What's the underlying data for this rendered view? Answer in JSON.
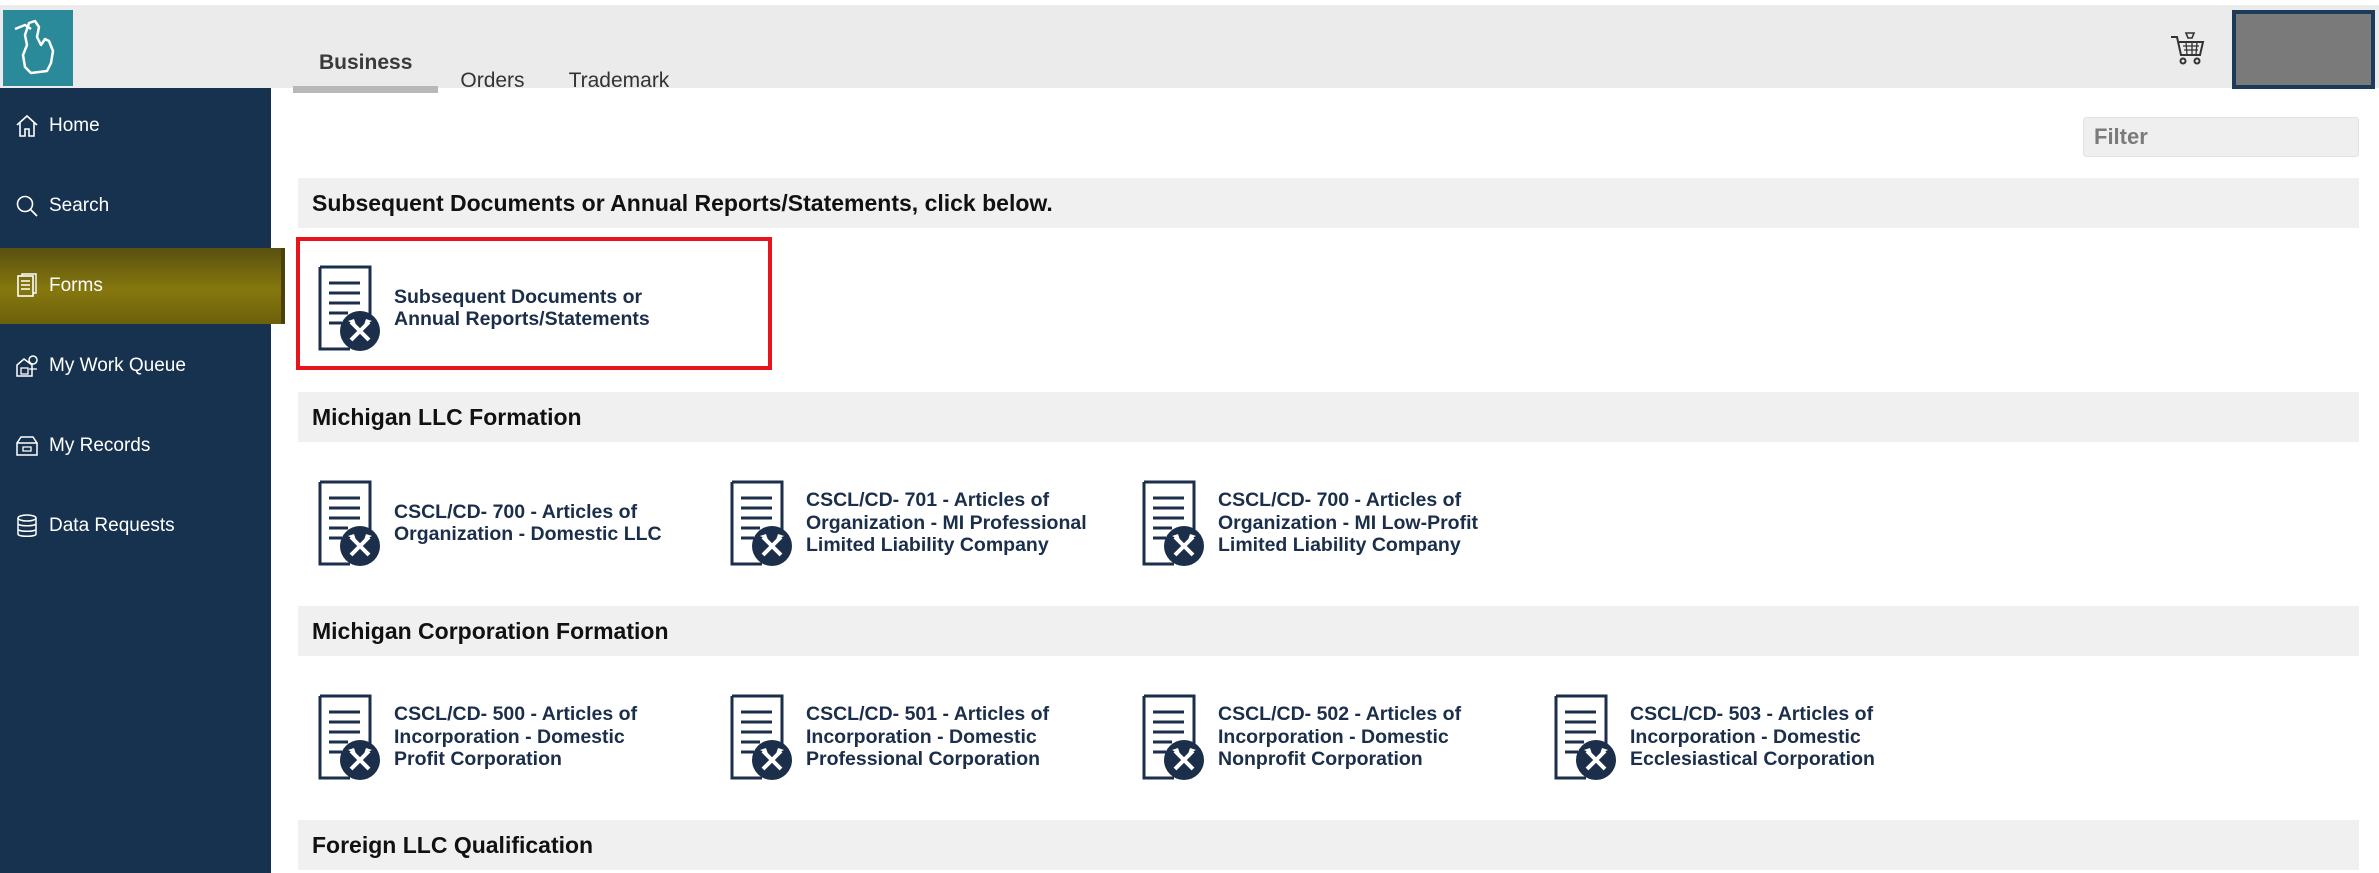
{
  "header": {
    "logo_icon": "michigan-state-icon",
    "tabs": [
      {
        "label": "Business"
      },
      {
        "label": "Orders"
      },
      {
        "label": "Trademark"
      }
    ],
    "cart_icon": "cart-icon"
  },
  "sidebar": {
    "items": [
      {
        "label": "Home",
        "icon": "home-icon"
      },
      {
        "label": "Search",
        "icon": "search-icon"
      },
      {
        "label": "Forms",
        "icon": "forms-icon"
      },
      {
        "label": "My Work Queue",
        "icon": "work-queue-icon"
      },
      {
        "label": "My Records",
        "icon": "records-icon"
      },
      {
        "label": "Data Requests",
        "icon": "database-icon"
      }
    ]
  },
  "filter": {
    "placeholder": "Filter"
  },
  "sections": [
    {
      "title": "Subsequent Documents or Annual Reports/Statements, click below.",
      "cards": [
        {
          "line1": "Subsequent Documents or",
          "line2": "Annual Reports/Statements",
          "line3": ""
        }
      ]
    },
    {
      "title": "Michigan LLC Formation",
      "cards": [
        {
          "line1": "CSCL/CD- 700 - Articles of",
          "line2": "Organization - Domestic LLC",
          "line3": ""
        },
        {
          "line1": "CSCL/CD- 701 - Articles of",
          "line2": "Organization - MI Professional",
          "line3": "Limited Liability Company"
        },
        {
          "line1": "CSCL/CD- 700 - Articles of",
          "line2": "Organization - MI Low-Profit",
          "line3": "Limited Liability Company"
        }
      ]
    },
    {
      "title": "Michigan Corporation Formation",
      "cards": [
        {
          "line1": "CSCL/CD- 500 - Articles of",
          "line2": "Incorporation - Domestic",
          "line3": "Profit Corporation"
        },
        {
          "line1": "CSCL/CD- 501 - Articles of",
          "line2": "Incorporation - Domestic",
          "line3": "Professional Corporation"
        },
        {
          "line1": "CSCL/CD- 502 - Articles of",
          "line2": "Incorporation - Domestic",
          "line3": "Nonprofit Corporation"
        },
        {
          "line1": "CSCL/CD- 503 - Articles of",
          "line2": "Incorporation - Domestic",
          "line3": "Ecclesiastical Corporation"
        }
      ]
    },
    {
      "title": "Foreign LLC Qualification",
      "cards": []
    }
  ],
  "colors": {
    "sidebar": "#17324f",
    "active_nav": "#86780e",
    "highlight": "#e8141c",
    "logo": "#2a8a9a"
  }
}
